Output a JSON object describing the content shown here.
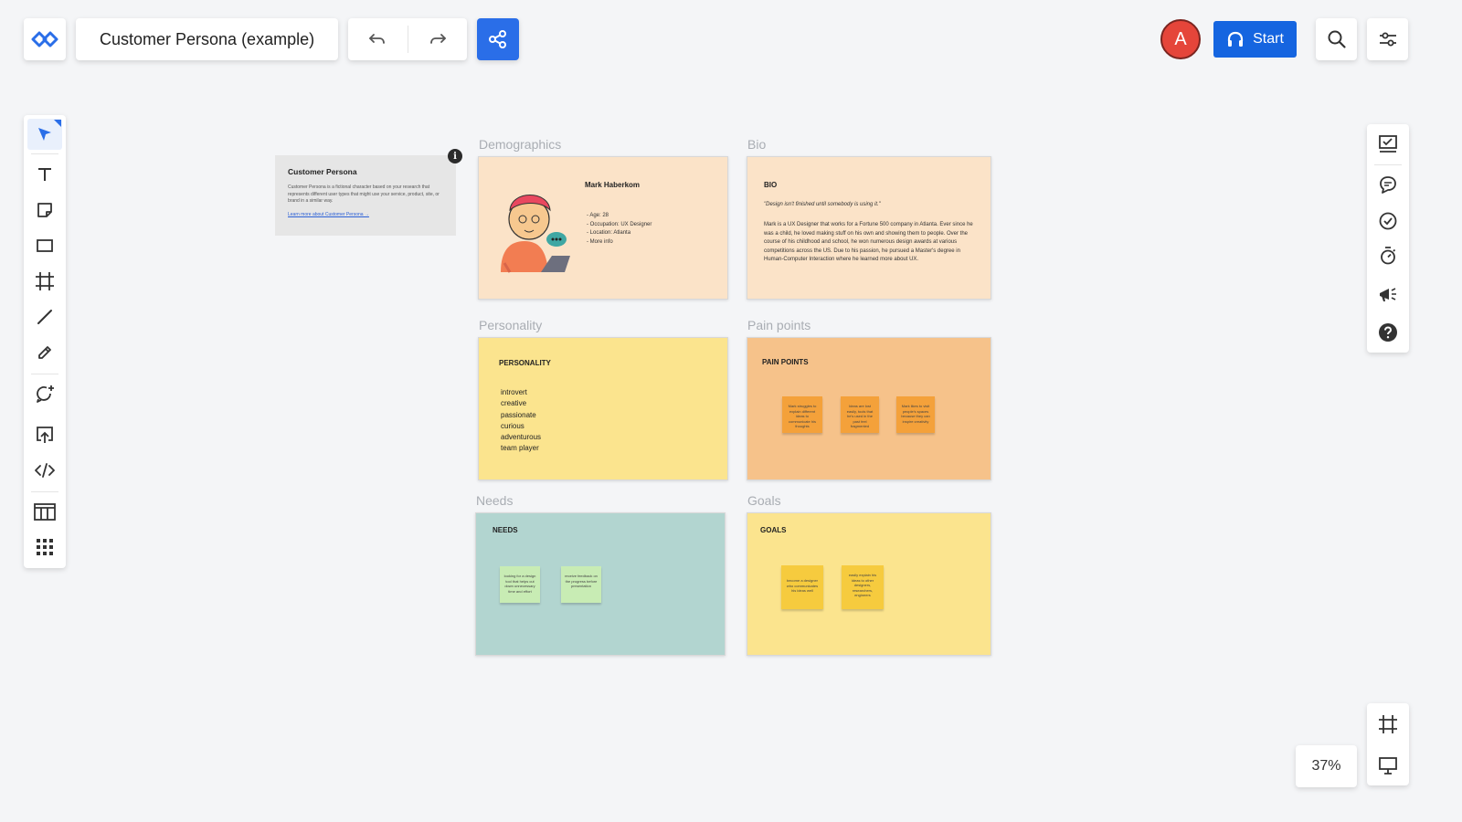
{
  "header": {
    "board_title": "Customer Persona (example)",
    "avatar_initial": "A",
    "start_label": "Start"
  },
  "zoom": "37%",
  "icons": {
    "logo": "miro-logo-icon",
    "undo": "undo-icon",
    "redo": "redo-icon",
    "share": "share-icon",
    "headset": "headset-icon",
    "search": "search-icon",
    "settings": "settings-sliders-icon"
  },
  "left_tools": [
    "select",
    "text",
    "sticky-note",
    "shape",
    "frame",
    "line",
    "pen",
    "comment-add",
    "upload",
    "embed",
    "templates",
    "apps"
  ],
  "right_tools": [
    "present-checklist",
    "chat",
    "check-circle",
    "timer",
    "announce",
    "help"
  ],
  "colors": {
    "accent": "#2a6ee8",
    "start_button": "#1565e0",
    "avatar": "#e5453a",
    "demographics_bg": "#fbe3c8",
    "bio_bg": "#fbe3c8",
    "personality_bg": "#fbe48e",
    "pain_points_bg": "#f6c28a",
    "needs_bg": "#b2d5d0",
    "goals_bg": "#fbe48e",
    "sticky_orange": "#f4a13a",
    "sticky_green": "#c8ecb4",
    "sticky_yellow": "#f6cb3e"
  },
  "info_card": {
    "title": "Customer Persona",
    "text": "Customer Persona is a fictional character based on your research that represents different user types that might use your service, product, site, or brand in a similar way.",
    "link": "Learn more about Customer Persona →",
    "info_glyph": "i"
  },
  "sections": {
    "demographics": {
      "label": "Demographics",
      "name": "Mark Haberkom",
      "details": [
        "- Age: 28",
        "- Occupation: UX Designer",
        "- Location: Atlanta",
        "- More info"
      ]
    },
    "bio": {
      "label": "Bio",
      "title": "BIO",
      "quote": "\"Design isn't finished until somebody is using it.\"",
      "text": "Mark is a UX Designer that works for a Fortune 500 company in Atlanta. Ever since he was a child, he loved making stuff on his own and showing them to people. Over the course of his childhood and school, he won numerous design awards at various competitions across the US. Due to his passion, he pursued a Master's degree in Human-Computer Interaction where he learned more about UX."
    },
    "personality": {
      "label": "Personality",
      "title": "PERSONALITY",
      "traits": [
        "introvert",
        "creative",
        "passionate",
        "curious",
        "adventurous",
        "team player"
      ]
    },
    "pain_points": {
      "label": "Pain points",
      "title": "PAIN POINTS",
      "stickies": [
        "Mark struggles to explain different ideas to communicate his thoughts",
        "Ideas are lost easily, tools that he's used in the past feel fragmented",
        "Mark likes to visit people's spaces because they can inspire creativity"
      ]
    },
    "needs": {
      "label": "Needs",
      "title": "NEEDS",
      "stickies": [
        "looking for a design tool that helps cut down unnecessary time and effort",
        "receive feedback on the progress before presentation"
      ]
    },
    "goals": {
      "label": "Goals",
      "title": "GOALS",
      "stickies": [
        "become a designer who communicates his ideas well",
        "easily explain his ideas to other designers, researchers, engineers"
      ]
    }
  }
}
